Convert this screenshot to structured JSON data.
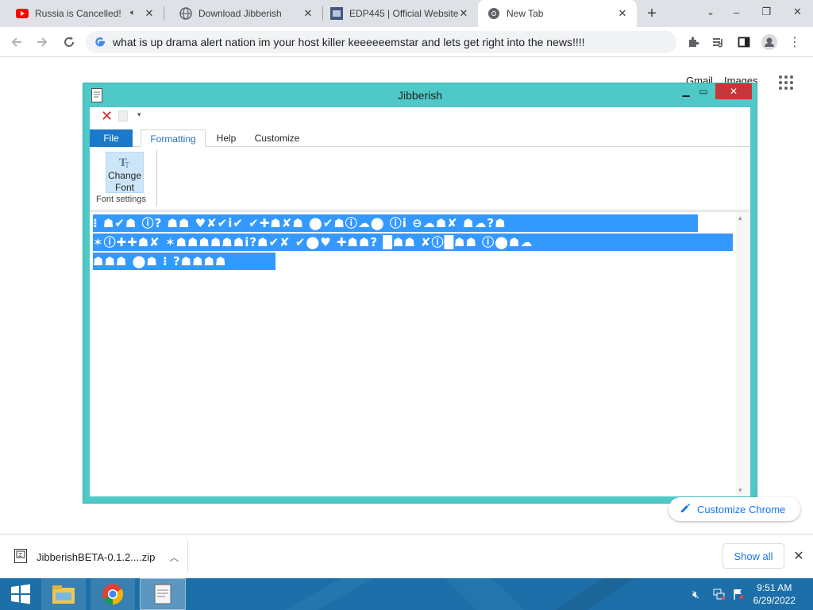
{
  "browser": {
    "tabs": [
      {
        "title": "Russia is Cancelled! ",
        "icon": "youtube-icon"
      },
      {
        "title": "Download Jibberish",
        "icon": "globe-icon"
      },
      {
        "title": "EDP445 | Official Website",
        "icon": "site-favicon-icon"
      },
      {
        "title": "New Tab",
        "icon": "chrome-icon"
      }
    ],
    "new_tab_symbol": "+",
    "address": "what is up drama alert nation im your host killer keeeeeemstar and lets get right into the news!!!!",
    "ntp_links": [
      "Gmail",
      "Images"
    ],
    "customize_label": "Customize Chrome"
  },
  "app": {
    "title": "Jibberish",
    "ribbon_tabs": [
      "File",
      "Formatting",
      "Help",
      "Customize"
    ],
    "change_font_label": "Change Font",
    "group_label": "Font settings",
    "gibberish_lines": [
      "⁝ ☗✔☗ ⓘ? ☗☗ ♥✘✔ⅰ✔ ✔✚☗✘☗ ⬤✔☗ⓘ☁⬤ ⓘⅰ ⊖☁☗✘ ☗☁?☗",
      "✶ⓘ✚✚☗✘ ✶☗☗☗☗☗☗ⅰ?☗✔✘ ✔⬤♥ ✚☗☗? █☗☗ ✘ⓘ█☗☗ ⓘ⬤☗☁",
      "☗☗☗ ⬤☗ ⁝ ?☗☗☗☗"
    ]
  },
  "download": {
    "filename": "JibberishBETA-0.1.2....zip",
    "show_all": "Show all"
  },
  "taskbar": {
    "time": "9:51 AM",
    "date": "6/29/2022"
  },
  "colors": {
    "window_frame": "#4fc9c7",
    "selection": "#3399ff",
    "taskbar": "#1c6fa8",
    "file_tab": "#1979ca",
    "link_blue": "#1a73e8"
  }
}
